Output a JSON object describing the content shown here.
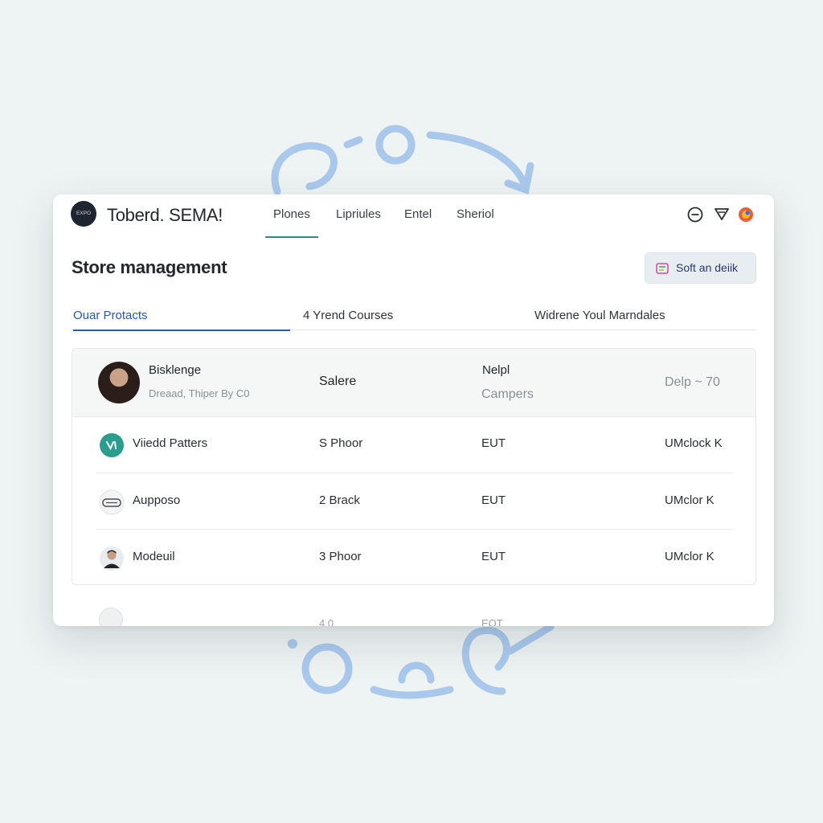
{
  "app": {
    "logo_text": "EXPO",
    "name": "Toberd. SEMA!"
  },
  "nav": {
    "items": [
      "Plones",
      "Lipriules",
      "Entel",
      "Sheriol"
    ],
    "active_index": 0
  },
  "header_icons": [
    "minus-circle-icon",
    "filter-icon",
    "profile-badge-icon"
  ],
  "page": {
    "title": "Store management",
    "action_label": "Soft an deiik"
  },
  "tabs": [
    {
      "label": "Ouar Protacts",
      "active": true
    },
    {
      "label": "4 Yrend Courses",
      "active": false
    },
    {
      "label": "Widrene Youl Marndales",
      "active": false
    }
  ],
  "table": {
    "header": {
      "name": "Bisklenge",
      "subtitle": "Dreaad, Thiper By C0",
      "col2": "Salere",
      "col3": "Nelpl",
      "col3_sub": "Campers",
      "col4": "Delp  ~  70"
    },
    "rows": [
      {
        "icon": "teal-check-icon",
        "name": "Viiedd Patters",
        "col2": "S Phoor",
        "col3": "EUT",
        "col4": "UMclock K"
      },
      {
        "icon": "device-icon",
        "name": "Aupposo",
        "col2": "2 Brack",
        "col3": "EUT",
        "col4": "UMclor K"
      },
      {
        "icon": "person-avatar-icon",
        "name": "Modeuil",
        "col2": "3 Phoor",
        "col3": "EUT",
        "col4": "UMclor K"
      }
    ],
    "partial_row": {
      "col2": "4 0",
      "col3": "EOT"
    }
  },
  "colors": {
    "accent_blue": "#2a5aa8",
    "accent_teal": "#2e8a82",
    "decoration": "#a9c8ec"
  }
}
